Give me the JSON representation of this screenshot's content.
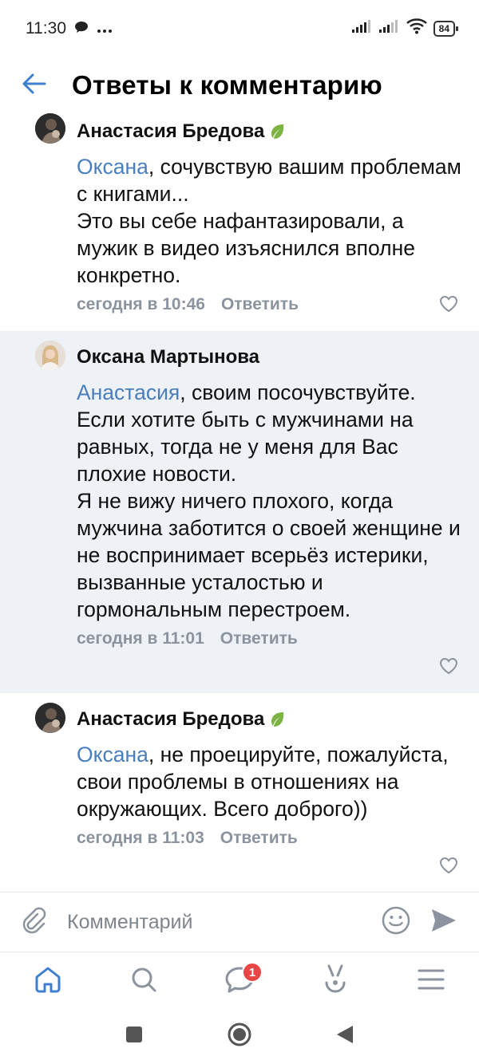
{
  "status": {
    "time": "11:30",
    "battery": "84",
    "icons": [
      "message-icon",
      "more-icon",
      "signal-icon",
      "signal-icon",
      "wifi-icon",
      "battery-icon"
    ]
  },
  "header": {
    "title": "Ответы к комментарию",
    "back_icon": "back-arrow-icon"
  },
  "comments": [
    {
      "author": "Анастасия Бредова",
      "mention": "Оксана",
      "text": ", сочувствую вашим проблемам с книгами...\nЭто вы себе нафантазировали, а мужик в видео изъяснился вполне конкретно.",
      "time": "сегодня в 10:46",
      "reply_label": "Ответить"
    },
    {
      "author": "Оксана Мартынова",
      "mention": "Анастасия",
      "text": ", своим посочувствуйте. Если хотите быть с мужчинами на равных, тогда не у меня для Вас плохие новости.\nЯ не вижу ничего плохого, когда мужчина заботится о своей женщине и не воспринимает всерьёз истерики, вызванные усталостью и гормональным перестроем.",
      "time": "сегодня в 11:01",
      "reply_label": "Ответить"
    },
    {
      "author": "Анастасия Бредова",
      "mention": "Оксана",
      "text": ", не проецируйте, пожалуйста, свои проблемы в отношениях на окружающих. Всего доброго))",
      "time": "сегодня в 11:03",
      "reply_label": "Ответить"
    }
  ],
  "composer": {
    "placeholder": "Комментарий"
  },
  "tabbar": {
    "items": [
      "home-icon",
      "search-icon",
      "messages-icon",
      "clips-icon",
      "menu-icon"
    ],
    "messages_badge": "1"
  },
  "colors": {
    "accent": "#4a7fbf",
    "highlight_bg": "#eef1f5",
    "meta_text": "#8b949e",
    "badge": "#e64646"
  }
}
